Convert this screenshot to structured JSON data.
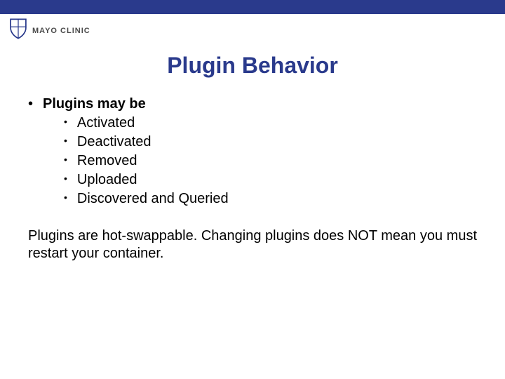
{
  "brand": {
    "name": "MAYO CLINIC"
  },
  "title": "Plugin Behavior",
  "bullets": {
    "level1": "Plugins may be",
    "level2": {
      "0": "Activated",
      "1": "Deactivated",
      "2": "Removed",
      "3": "Uploaded",
      "4": "Discovered and Queried"
    }
  },
  "paragraph": "Plugins are hot-swappable. Changing plugins does NOT mean you must restart your container.",
  "colors": {
    "accent": "#2a3a8c"
  }
}
